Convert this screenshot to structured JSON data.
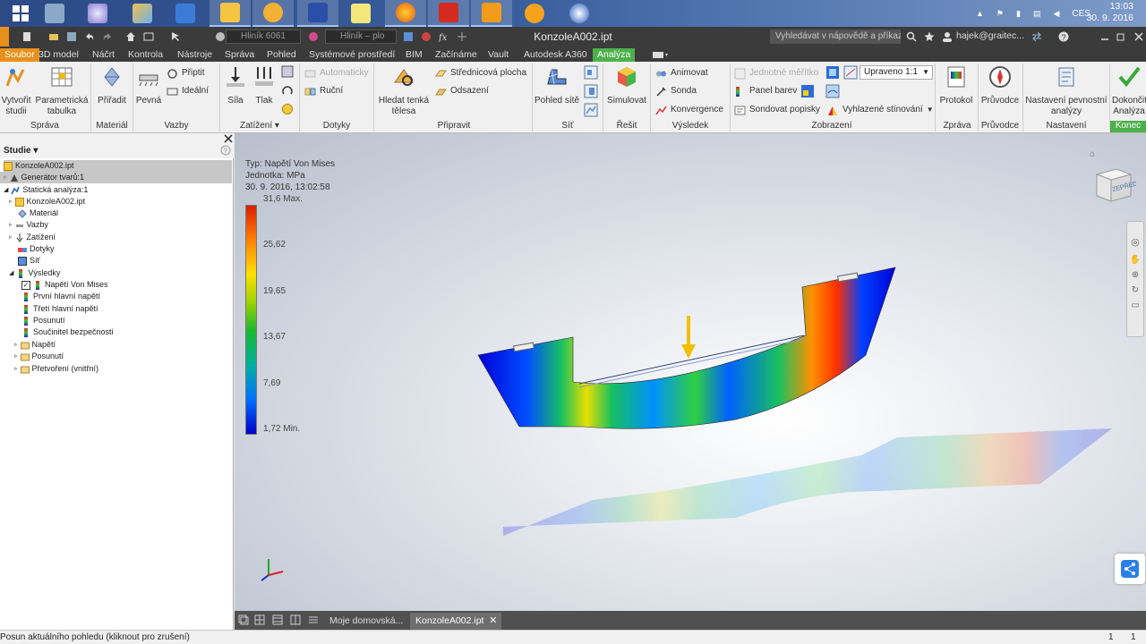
{
  "taskbar": {
    "apps": [
      "windows-start",
      "calculator",
      "paint-cd",
      "paint",
      "word",
      "file-explorer",
      "thunderbird",
      "save",
      "sticky-notes",
      "firefox",
      "acrobat",
      "inventor",
      "media-player",
      "molecule-app"
    ],
    "clock_time": "13:03",
    "clock_date": "30. 9. 2016",
    "language": "CES"
  },
  "qat": {
    "material": "Hliník 6061",
    "appearance": "Hliník – plo",
    "title": "KonzoleA002.ipt",
    "help_search_placeholder": "Vyhledávat v nápovědě a příkazech",
    "user": "hajek@graitec..."
  },
  "tabs": [
    {
      "label": "Soubor",
      "kind": "file"
    },
    {
      "label": "3D model"
    },
    {
      "label": "Náčrt"
    },
    {
      "label": "Kontrola"
    },
    {
      "label": "Nástroje"
    },
    {
      "label": "Správa"
    },
    {
      "label": "Pohled"
    },
    {
      "label": "Systémové prostředí"
    },
    {
      "label": "BIM"
    },
    {
      "label": "Začínáme"
    },
    {
      "label": "Vault"
    },
    {
      "label": "Autodesk A360"
    },
    {
      "label": "Analýza",
      "kind": "active"
    }
  ],
  "ribbon": {
    "sprava": {
      "title": "Správa",
      "create_study": "Vytvořit\nstudii",
      "param_table": "Parametrická\ntabulka"
    },
    "material": {
      "title": "Materiál",
      "assign": "Přiřadit"
    },
    "vazby": {
      "title": "Vazby",
      "fixed": "Pevná",
      "pinned": "Připtit",
      "frictionless": "Ideální"
    },
    "zatizeni": {
      "title": "Zatížení",
      "force": "Síla",
      "pressure": "Tlak"
    },
    "dotyky": {
      "title": "Dotyky",
      "automatic": "Automaticky",
      "manual": "Ruční"
    },
    "pripravit": {
      "title": "Připravit",
      "find_thin": "Hledat tenká\ntělesa",
      "midsurface": "Střednicová plocha",
      "offset": "Odsazení"
    },
    "sit": {
      "title": "Síť",
      "mesh_view": "Pohled sítě"
    },
    "resit": {
      "title": "Řešit",
      "simulate": "Simulovat"
    },
    "vysledek": {
      "title": "Výsledek",
      "animate": "Animovat",
      "probe": "Sonda",
      "convergence": "Konvergence"
    },
    "zobrazeni": {
      "title": "Zobrazení",
      "same_scale": "Jednotné měřítko",
      "adjusted": "Upraveno 1:1",
      "color_bar": "Panel barev",
      "probe_labels": "Sondovat popisky",
      "smooth_shading": "Vyhlazené stínování"
    },
    "zprava": {
      "title": "Zpráva",
      "report": "Protokol"
    },
    "pruvodce": {
      "title": "Průvodce",
      "guide": "Průvodce"
    },
    "nastaveni": {
      "title": "Nastavení",
      "stress_settings": "Nastavení pevnostní\nanalýzy"
    },
    "konec": {
      "title": "Konec",
      "finish": "Dokončit\nAnalýza"
    }
  },
  "browser": {
    "title": "Studie",
    "items": [
      {
        "label": "KonzoleA002.ipt",
        "icon": "part-icon",
        "selected": true
      },
      {
        "label": "Generátor tvarů:1",
        "icon": "shape-generator-icon",
        "selected": true
      },
      {
        "label": "Statická analýza:1",
        "icon": "static-analysis-icon"
      },
      {
        "label": "KonzoleA002.ipt",
        "icon": "part-icon"
      },
      {
        "label": "Materiál",
        "icon": "material-icon"
      },
      {
        "label": "Vazby",
        "icon": "constraint-icon"
      },
      {
        "label": "Zatížení",
        "icon": "load-icon"
      },
      {
        "label": "Dotyky",
        "icon": "contact-icon"
      },
      {
        "label": "Síť",
        "icon": "mesh-icon"
      },
      {
        "label": "Výsledky",
        "icon": "results-icon"
      },
      {
        "label": "Napětí Von Mises",
        "icon": "result-map-icon",
        "checked": true
      },
      {
        "label": "První hlavní napětí",
        "icon": "result-map-icon"
      },
      {
        "label": "Třetí hlavní napětí",
        "icon": "result-map-icon"
      },
      {
        "label": "Posunutí",
        "icon": "result-map-icon"
      },
      {
        "label": "Součinitel bezpečnosti",
        "icon": "result-map-icon"
      },
      {
        "label": "Napětí",
        "icon": "folder-icon"
      },
      {
        "label": "Posunutí",
        "icon": "folder-icon"
      },
      {
        "label": "Přetvoření (vnitřní)",
        "icon": "folder-icon"
      }
    ]
  },
  "legend": {
    "type": "Typ: Napětí Von Mises",
    "unit": "Jednotka: MPa",
    "date": "30. 9. 2016, 13:02:58",
    "max": "31,6 Max.",
    "ticks": [
      "25,62",
      "19,65",
      "13,67",
      "7,69"
    ],
    "min": "1,72 Min.",
    "colors": [
      "#d81e00",
      "#ff7a00",
      "#ffe000",
      "#18b830",
      "#00b0a0",
      "#0070ff",
      "#0000c8"
    ]
  },
  "viewcube": {
    "face_label": "ZEPŘEDU"
  },
  "doctabs": [
    {
      "label": "Moje domovská..."
    },
    {
      "label": "KonzoleA002.ipt",
      "active": true
    }
  ],
  "status": {
    "message": "Posun aktuálního pohledu (kliknout pro zrušení)",
    "count1": "1",
    "count2": "1"
  }
}
